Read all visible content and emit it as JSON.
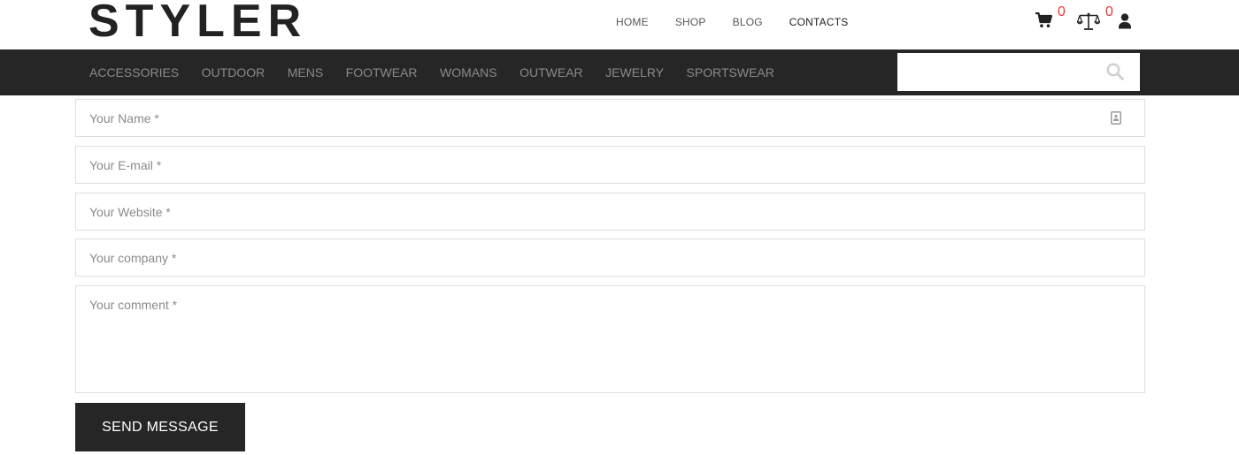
{
  "header": {
    "logo": "STYLER",
    "nav": [
      "HOME",
      "SHOP",
      "BLOG",
      "CONTACTS"
    ],
    "active_nav": "CONTACTS",
    "cart_count": "0",
    "compare_count": "0",
    "badge_color": "#e53935"
  },
  "categories": [
    "ACCESSORIES",
    "OUTDOOR",
    "MENS",
    "FOOTWEAR",
    "WOMANS",
    "OUTWEAR",
    "JEWELRY",
    "SPORTSWEAR"
  ],
  "search": {
    "placeholder": "",
    "icon": "search-icon"
  },
  "form": {
    "name_placeholder": "Your Name *",
    "email_placeholder": "Your E-mail *",
    "website_placeholder": "Your Website *",
    "company_placeholder": "Your company *",
    "comment_placeholder": "Your comment *",
    "submit_label": "SEND MESSAGE"
  },
  "colors": {
    "dark_bar": "#262626",
    "accent_badge": "#e53935"
  }
}
